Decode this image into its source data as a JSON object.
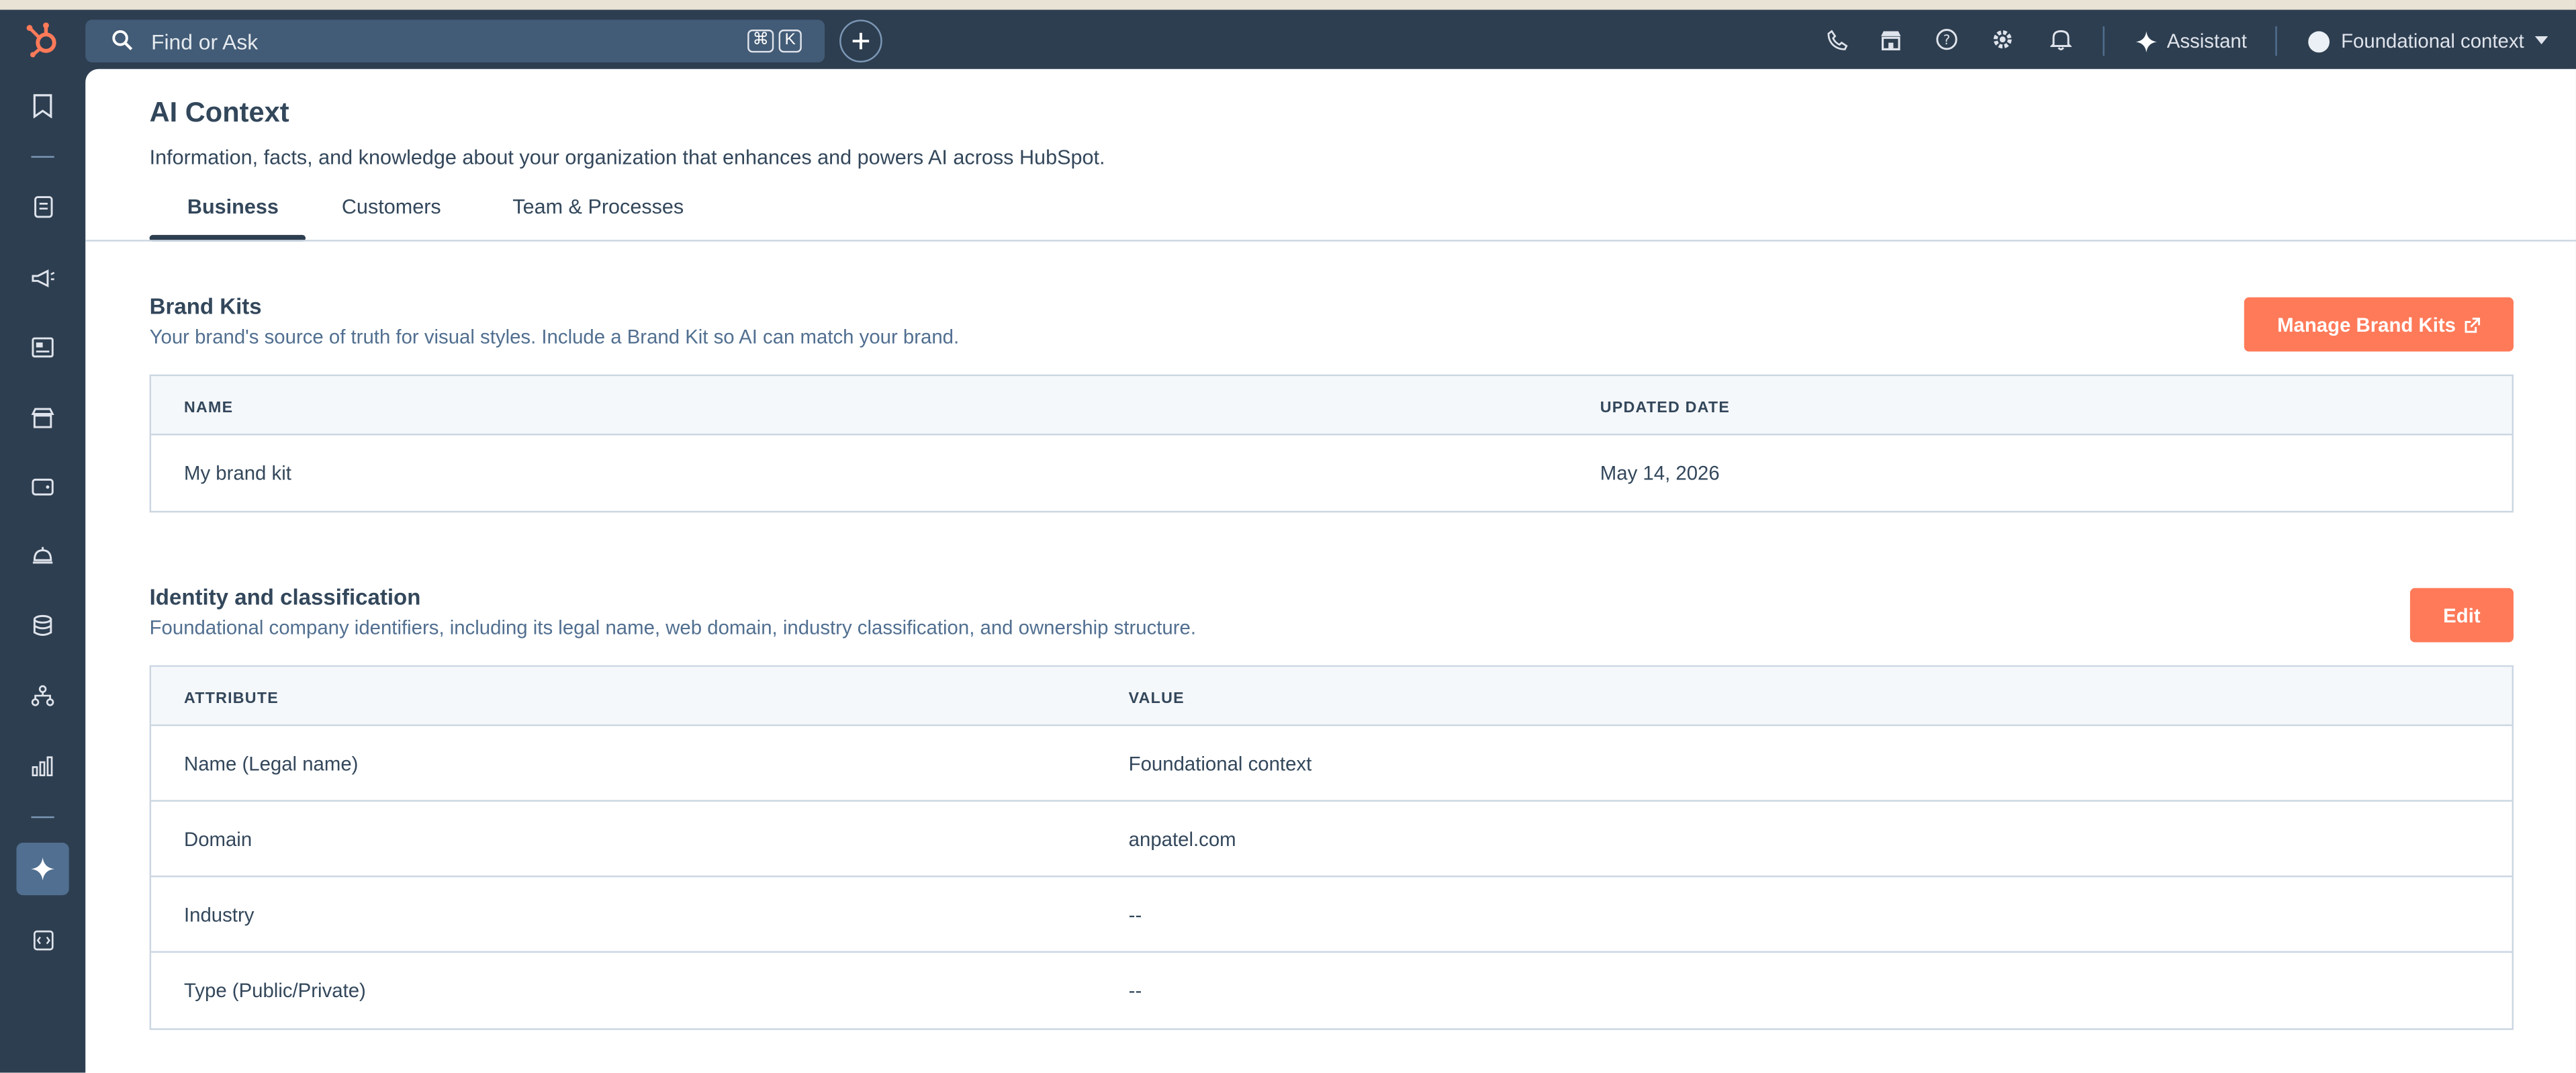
{
  "topbar": {
    "search_placeholder": "Find or Ask",
    "shortcut_keys": [
      "⌘",
      "K"
    ],
    "assistant_label": "Assistant",
    "account_name": "Foundational context"
  },
  "page": {
    "title": "AI Context",
    "description": "Information, facts, and knowledge about your organization that enhances and powers AI across HubSpot."
  },
  "tabs": [
    {
      "label": "Business",
      "active": true
    },
    {
      "label": "Customers",
      "active": false
    },
    {
      "label": "Team & Processes",
      "active": false
    }
  ],
  "brand_kits": {
    "title": "Brand Kits",
    "description": "Your brand's source of truth for visual styles. Include a Brand Kit so AI can match your brand.",
    "button_label": "Manage Brand Kits",
    "columns": [
      "NAME",
      "UPDATED DATE"
    ],
    "rows": [
      {
        "name": "My brand kit",
        "updated": "May 14, 2026"
      }
    ]
  },
  "identity": {
    "title": "Identity and classification",
    "description": "Foundational company identifiers, including its legal name, web domain, industry classification, and ownership structure.",
    "button_label": "Edit",
    "columns": [
      "ATTRIBUTE",
      "VALUE"
    ],
    "rows": [
      {
        "attribute": "Name (Legal name)",
        "value": "Foundational context"
      },
      {
        "attribute": "Domain",
        "value": "anpatel.com"
      },
      {
        "attribute": "Industry",
        "value": "--"
      },
      {
        "attribute": "Type (Public/Private)",
        "value": "--"
      }
    ]
  },
  "colors": {
    "nav_bg": "#2d3e50",
    "accent": "#ff7a59",
    "text": "#33475b"
  },
  "icons": {
    "sidebar": [
      "bookmark-icon",
      "contacts-icon",
      "marketing-megaphone-icon",
      "content-icon",
      "commerce-icon",
      "wallet-icon",
      "service-bell-icon",
      "database-icon",
      "org-chart-icon",
      "reports-icon",
      "ai-sparkle-icon",
      "developer-code-icon"
    ],
    "topbar": [
      "calling-icon",
      "marketplace-icon",
      "help-icon",
      "settings-gear-icon",
      "notifications-bell-icon"
    ]
  }
}
